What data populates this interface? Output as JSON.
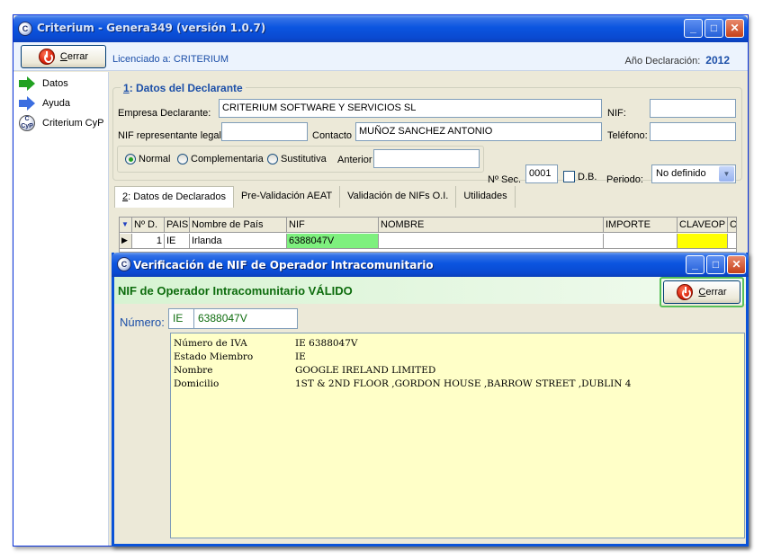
{
  "main_window": {
    "title": "Criterium - Genera349 (versión 1.0.7)",
    "app_icon_glyph": "C",
    "controls": {
      "minimize": "_",
      "maximize": "□",
      "close": "✕"
    }
  },
  "toolbar": {
    "close_prefix": "C",
    "close_rest": "errar",
    "licensee": "Licenciado a: CRITERIUM",
    "year_label": "Año Declaración:",
    "year_value": "2012"
  },
  "sidebar": {
    "items": [
      {
        "label": "Datos",
        "icon": "green-arrow-icon"
      },
      {
        "label": "Ayuda",
        "icon": "blue-arrow-icon"
      },
      {
        "label": "Criterium CyP",
        "icon": "criterium-cyp-icon"
      }
    ],
    "cyp_icon_text": "C\nCyP"
  },
  "declarante": {
    "title_num": "1",
    "title_rest": ": Datos del Declarante",
    "empresa_label": "Empresa Declarante:",
    "empresa_value": "CRITERIUM SOFTWARE Y SERVICIOS SL",
    "nif_label": "NIF:",
    "nif_value": "",
    "nif_rep_label": "NIF representante legal",
    "nif_rep_value": "",
    "contacto_label": "Contacto",
    "contacto_value": "MUÑOZ SANCHEZ ANTONIO",
    "telefono_label": "Teléfono:",
    "telefono_value": "",
    "radio_normal": "Normal",
    "radio_complementaria": "Complementaria",
    "radio_sustitutiva": "Sustitutiva",
    "anterior_label": "Anterior",
    "anterior_value": "",
    "nsec_label": "Nº Sec.",
    "nsec_value": "0001",
    "db_label": "D.B.",
    "periodo_label": "Periodo:",
    "periodo_value": "No definido"
  },
  "tabs": [
    {
      "num": "2",
      "rest": ": Datos de Declarados"
    },
    {
      "label": "Pre-Validación AEAT"
    },
    {
      "label": "Validación de NIFs O.I."
    },
    {
      "label": "Utilidades"
    }
  ],
  "grid": {
    "headers": [
      "▼",
      "Nº D.",
      "PAIS",
      "Nombre de País",
      "NIF",
      "NOMBRE",
      "IMPORTE",
      "CLAVEOP",
      "C"
    ],
    "row": [
      "▶",
      "1",
      "IE",
      "Irlanda",
      "6388047V",
      "",
      "",
      "",
      ""
    ],
    "nif_color": "#7ef07e",
    "claveop_color": "#ffff00"
  },
  "dialog": {
    "title": "Verificación de NIF de Operador Intracomunitario",
    "status": "NIF de Operador Intracomunitario VÁLIDO",
    "close_prefix": "C",
    "close_rest": "errar",
    "numero_label": "Número:",
    "country_code": "IE",
    "nif": "6388047V",
    "info": [
      {
        "k": "Número de IVA",
        "v": "IE 6388047V"
      },
      {
        "k": "Estado Miembro",
        "v": "IE"
      },
      {
        "k": "Nombre",
        "v": "GOOGLE IRELAND LIMITED"
      },
      {
        "k": "Domicilio",
        "v": "1ST & 2ND FLOOR ,GORDON HOUSE ,BARROW STREET ,DUBLIN 4"
      }
    ],
    "valid_color": "#0d6c0d"
  }
}
